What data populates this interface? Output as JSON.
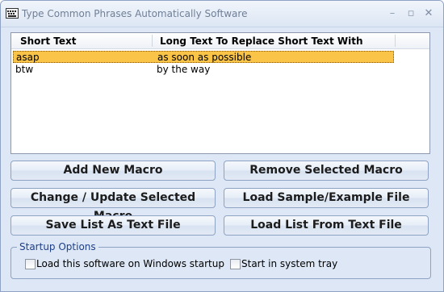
{
  "window": {
    "title": "Type Common Phrases Automatically Software",
    "controls": {
      "minimize": "–",
      "maximize": "▫",
      "close": "✕"
    }
  },
  "list": {
    "columns": [
      "Short Text",
      "Long Text To Replace Short Text With"
    ],
    "rows": [
      {
        "short": "asap",
        "long": "as soon as possible",
        "selected": true
      },
      {
        "short": "btw",
        "long": "by the way",
        "selected": false
      }
    ]
  },
  "buttons": {
    "add_macro": "Add New Macro",
    "remove_macro": "Remove Selected Macro",
    "change_macro": "Change / Update Selected Macro",
    "load_sample": "Load Sample/Example File",
    "save_list": "Save List As Text File",
    "load_list": "Load List From Text File"
  },
  "startup": {
    "title": "Startup Options",
    "load_on_startup": {
      "label": "Load this software on Windows startup",
      "checked": false
    },
    "start_in_tray": {
      "label": "Start in system tray",
      "checked": false
    }
  },
  "colors": {
    "selection": "#f9c448",
    "window_bg": "#dde7f5",
    "group_title": "#1e3f8a"
  }
}
